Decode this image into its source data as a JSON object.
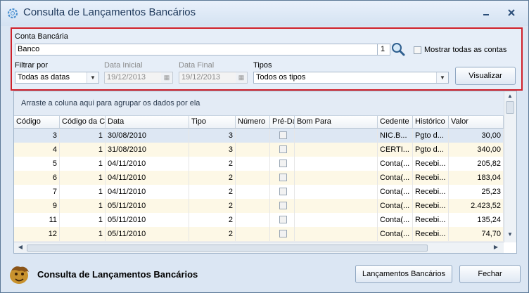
{
  "window": {
    "title": "Consulta de Lançamentos Bancários",
    "minimize_icon": "minimize-icon",
    "close_icon": "close-icon"
  },
  "filters": {
    "conta_label": "Conta Bancária",
    "conta_value": "Banco",
    "conta_code": "1",
    "mostrar_todas_label": "Mostrar todas as contas",
    "mostrar_todas_checked": false,
    "filtrar_label": "Filtrar por",
    "filtrar_value": "Todas as datas",
    "data_inicial_label": "Data Inicial",
    "data_inicial_value": "19/12/2013",
    "data_final_label": "Data Final",
    "data_final_value": "19/12/2013",
    "tipos_label": "Tipos",
    "tipos_value": "Todos os tipos",
    "visualizar_label": "Visualizar"
  },
  "grid": {
    "group_hint": "Arraste a coluna aqui para agrupar os dados por ela",
    "columns": [
      "Código",
      "Código da Co",
      "Data",
      "Tipo",
      "Número",
      "Pré-Da",
      "Bom Para",
      "Cedente",
      "Histórico",
      "Valor"
    ],
    "rows": [
      [
        "3",
        "1",
        "30/08/2010",
        "3",
        "",
        "",
        "",
        "NIC.B...",
        "Pgto d...",
        "30,00"
      ],
      [
        "4",
        "1",
        "31/08/2010",
        "3",
        "",
        "",
        "",
        "CERTI...",
        "Pgto d...",
        "340,00"
      ],
      [
        "5",
        "1",
        "04/11/2010",
        "2",
        "",
        "",
        "",
        "Conta(...",
        "Recebi...",
        "205,82"
      ],
      [
        "6",
        "1",
        "04/11/2010",
        "2",
        "",
        "",
        "",
        "Conta(...",
        "Recebi...",
        "183,04"
      ],
      [
        "7",
        "1",
        "04/11/2010",
        "2",
        "",
        "",
        "",
        "Conta(...",
        "Recebi...",
        "25,23"
      ],
      [
        "9",
        "1",
        "05/11/2010",
        "2",
        "",
        "",
        "",
        "Conta(...",
        "Recebi...",
        "2.423,52"
      ],
      [
        "11",
        "1",
        "05/11/2010",
        "2",
        "",
        "",
        "",
        "Conta(...",
        "Recebi...",
        "135,24"
      ],
      [
        "12",
        "1",
        "05/11/2010",
        "2",
        "",
        "",
        "",
        "Conta(...",
        "Recebi...",
        "74,70"
      ]
    ]
  },
  "footer": {
    "title": "Consulta de Lançamentos Bancários",
    "lancamentos_label": "Lançamentos Bancários",
    "fechar_label": "Fechar"
  },
  "colors": {
    "highlight_border": "#d0202a",
    "title_text": "#1e395b",
    "selected_row": "#dde7f3",
    "alt_row": "#fdf8e6"
  }
}
